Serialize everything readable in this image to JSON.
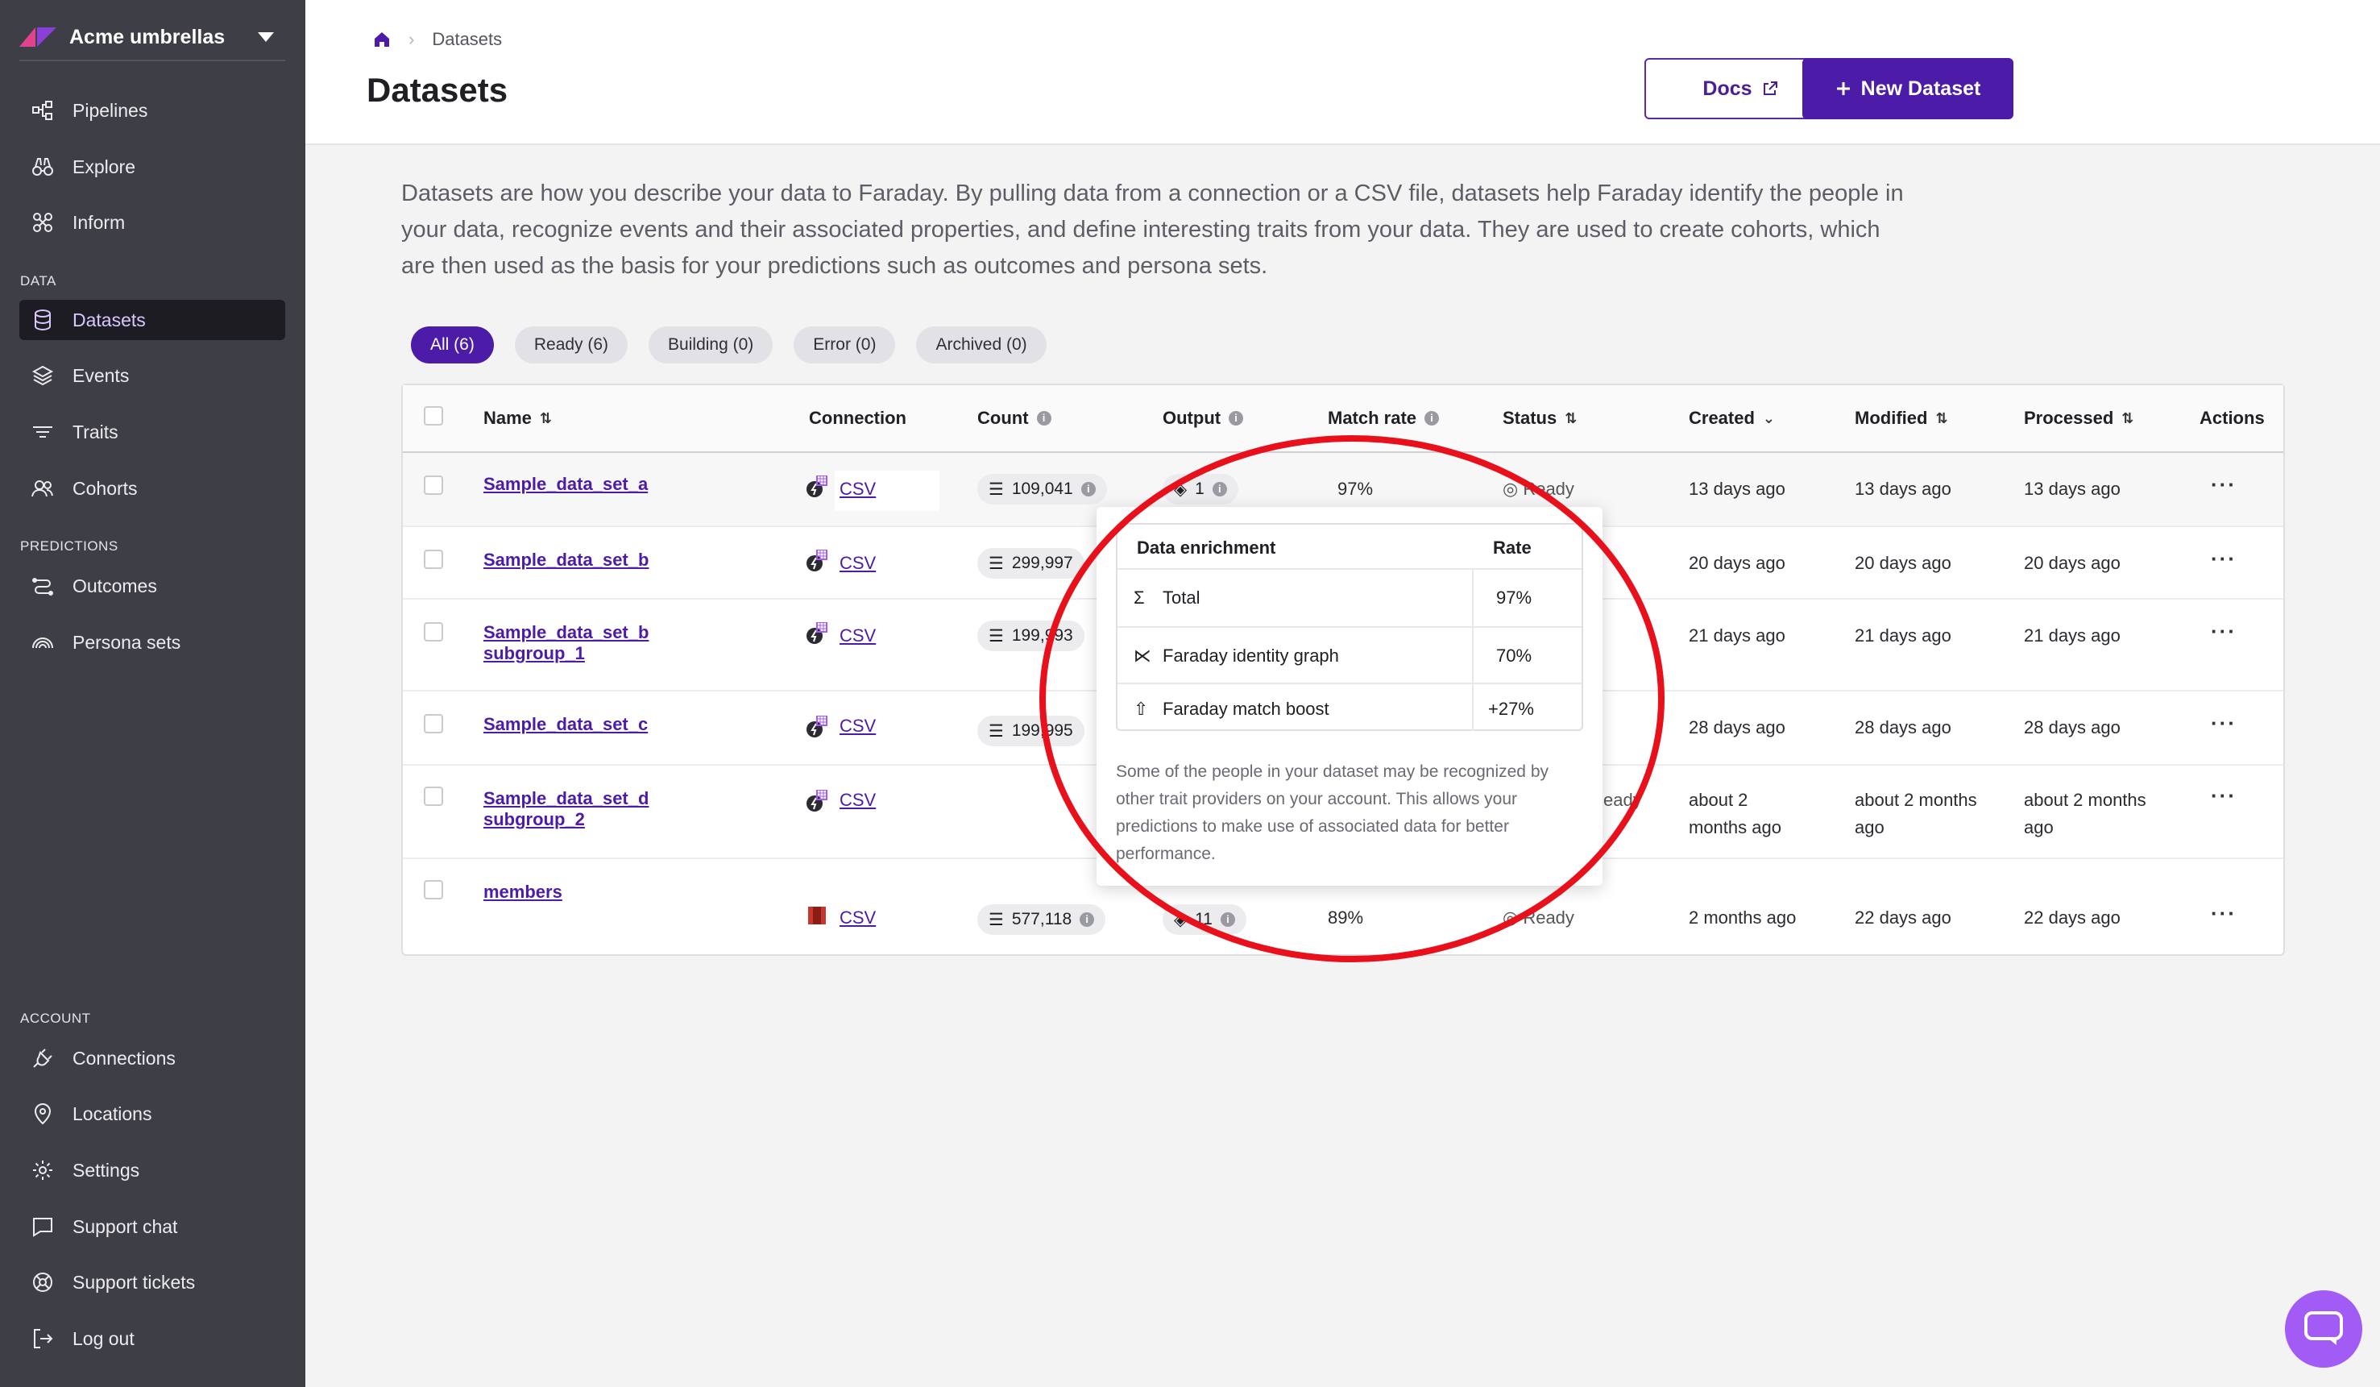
{
  "sidebar": {
    "org_name": "Acme umbrellas",
    "nav_main": [
      {
        "label": "Pipelines",
        "icon": "pipelines-icon"
      },
      {
        "label": "Explore",
        "icon": "binoculars-icon"
      },
      {
        "label": "Inform",
        "icon": "inform-icon"
      }
    ],
    "section_data": "DATA",
    "nav_data": [
      {
        "label": "Datasets",
        "icon": "database-icon",
        "active": true
      },
      {
        "label": "Events",
        "icon": "layers-icon"
      },
      {
        "label": "Traits",
        "icon": "traits-icon"
      },
      {
        "label": "Cohorts",
        "icon": "cohorts-icon"
      }
    ],
    "section_predictions": "PREDICTIONS",
    "nav_predictions": [
      {
        "label": "Outcomes",
        "icon": "outcomes-icon"
      },
      {
        "label": "Persona sets",
        "icon": "persona-icon"
      }
    ],
    "section_account": "ACCOUNT",
    "nav_account": [
      {
        "label": "Connections",
        "icon": "plug-icon"
      },
      {
        "label": "Locations",
        "icon": "pin-icon"
      },
      {
        "label": "Settings",
        "icon": "gear-icon"
      },
      {
        "label": "Support chat",
        "icon": "chat-icon"
      },
      {
        "label": "Support tickets",
        "icon": "lifebuoy-icon"
      },
      {
        "label": "Log out",
        "icon": "logout-icon"
      }
    ],
    "colors": {
      "bg": "#3e3e46",
      "active_bg": "#1c1c22",
      "active_text": "#d9c8ff"
    }
  },
  "header": {
    "breadcrumb_current": "Datasets",
    "title": "Datasets",
    "docs_label": "Docs",
    "new_label": "New Dataset"
  },
  "intro": "Datasets are how you describe your data to Faraday. By pulling data from a connection or a CSV file, datasets help Faraday identify the people in your data, recognize events and their associated properties, and define interesting traits from your data. They are used to create cohorts, which are then used as the basis for your predictions such as outcomes and persona sets.",
  "filters": [
    {
      "label": "All (6)",
      "active": true
    },
    {
      "label": "Ready (6)"
    },
    {
      "label": "Building (0)"
    },
    {
      "label": "Error (0)"
    },
    {
      "label": "Archived (0)"
    }
  ],
  "table": {
    "headers": {
      "name": "Name",
      "connection": "Connection",
      "count": "Count",
      "output": "Output",
      "match_rate": "Match rate",
      "status": "Status",
      "created": "Created",
      "modified": "Modified",
      "processed": "Processed",
      "actions": "Actions"
    },
    "rows": [
      {
        "name": "Sample_data_set_a",
        "name2": "",
        "connection": "CSV",
        "count": "109,041",
        "output": "1",
        "match_rate": "97%",
        "status": "Ready",
        "created": "13 days ago",
        "modified": "13 days ago",
        "processed": "13 days ago"
      },
      {
        "name": "Sample_data_set_b",
        "name2": "",
        "connection": "CSV",
        "count": "299,997",
        "created": "20 days ago",
        "modified": "20 days ago",
        "processed": "20 days ago"
      },
      {
        "name": "Sample_data_set_b",
        "name2": "subgroup_1",
        "connection": "CSV",
        "count": "199,993",
        "created": "21 days ago",
        "modified": "21 days ago",
        "processed": "21 days ago"
      },
      {
        "name": "Sample_data_set_c",
        "name2": "",
        "connection": "CSV",
        "count": "199,995",
        "created": "28 days ago",
        "modified": "28 days ago",
        "processed": "28 days ago"
      },
      {
        "name": "Sample_data_set_d",
        "name2": "subgroup_2",
        "connection": "CSV",
        "status_partial": "eady",
        "created": "about 2",
        "created2": "months ago",
        "modified": "about 2 months",
        "modified2": "ago",
        "processed": "about 2 months",
        "processed2": "ago"
      },
      {
        "name": "members",
        "name2": "",
        "connection": "CSV",
        "count": "577,118",
        "output": "11",
        "match_rate": "89%",
        "status": "Ready",
        "created": "2 months ago",
        "modified": "22 days ago",
        "processed": "22 days ago"
      }
    ],
    "actions_glyph": "···"
  },
  "popover": {
    "col_label": "Data enrichment",
    "col_rate": "Rate",
    "rows": [
      {
        "label": "Total",
        "rate": "97%",
        "icon": "sigma-icon"
      },
      {
        "label": "Faraday identity graph",
        "rate": "70%",
        "icon": "graph-icon"
      },
      {
        "label": "Faraday match boost",
        "rate": "+27%",
        "icon": "boost-icon"
      }
    ],
    "description": "Some of the people in your dataset may be recognized by other trait providers on your account. This allows your predictions to make use of associated data for better performance."
  },
  "accent": "#4c1ca8",
  "annotation_color": "#e8101a"
}
